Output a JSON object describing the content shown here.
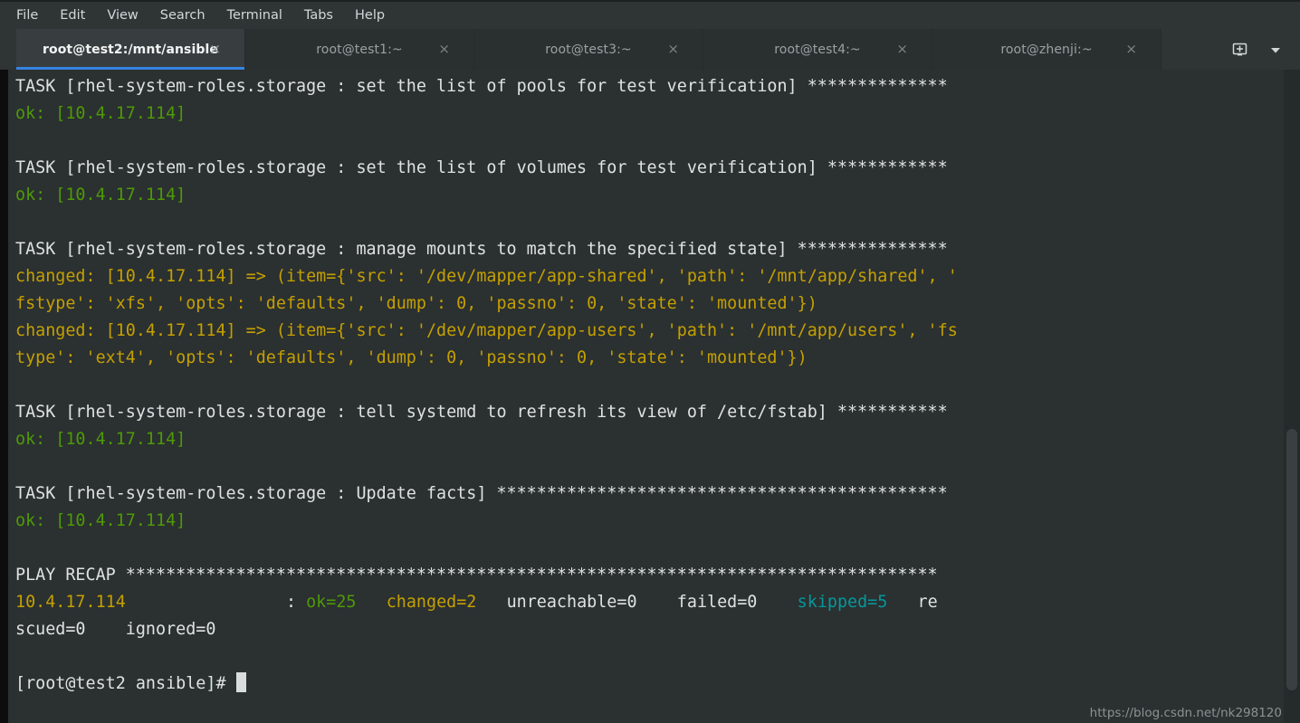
{
  "window": {
    "accent_color": "#3584e4",
    "background": "#2b3031"
  },
  "menubar": {
    "items": [
      {
        "label": "File"
      },
      {
        "label": "Edit"
      },
      {
        "label": "View"
      },
      {
        "label": "Search"
      },
      {
        "label": "Terminal"
      },
      {
        "label": "Tabs"
      },
      {
        "label": "Help"
      }
    ]
  },
  "tabs": {
    "close_glyph": "×",
    "items": [
      {
        "label": "root@test2:/mnt/ansible",
        "active": true
      },
      {
        "label": "root@test1:~",
        "active": false
      },
      {
        "label": "root@test3:~",
        "active": false
      },
      {
        "label": "root@test4:~",
        "active": false
      },
      {
        "label": "root@zhenji:~",
        "active": false
      }
    ],
    "actions": [
      {
        "name": "new-terminal-icon"
      },
      {
        "name": "chevron-down-icon"
      }
    ]
  },
  "terminal": {
    "prompt": "[root@test2 ansible]# ",
    "host": "10.4.17.114",
    "lines": [
      {
        "segments": [
          {
            "text": "TASK [rhel-system-roles.storage : set the list of pools for test verification] **************",
            "color": "white"
          }
        ]
      },
      {
        "segments": [
          {
            "text": "ok: [10.4.17.114]",
            "color": "green"
          }
        ]
      },
      {
        "segments": [
          {
            "text": "",
            "color": "white"
          }
        ]
      },
      {
        "segments": [
          {
            "text": "TASK [rhel-system-roles.storage : set the list of volumes for test verification] ************",
            "color": "white"
          }
        ]
      },
      {
        "segments": [
          {
            "text": "ok: [10.4.17.114]",
            "color": "green"
          }
        ]
      },
      {
        "segments": [
          {
            "text": "",
            "color": "white"
          }
        ]
      },
      {
        "segments": [
          {
            "text": "TASK [rhel-system-roles.storage : manage mounts to match the specified state] ***************",
            "color": "white"
          }
        ]
      },
      {
        "segments": [
          {
            "text": "changed: [10.4.17.114] => (item={'src': '/dev/mapper/app-shared', 'path': '/mnt/app/shared', '",
            "color": "yellow"
          }
        ]
      },
      {
        "segments": [
          {
            "text": "fstype': 'xfs', 'opts': 'defaults', 'dump': 0, 'passno': 0, 'state': 'mounted'})",
            "color": "yellow"
          }
        ]
      },
      {
        "segments": [
          {
            "text": "changed: [10.4.17.114] => (item={'src': '/dev/mapper/app-users', 'path': '/mnt/app/users', 'fs",
            "color": "yellow"
          }
        ]
      },
      {
        "segments": [
          {
            "text": "type': 'ext4', 'opts': 'defaults', 'dump': 0, 'passno': 0, 'state': 'mounted'})",
            "color": "yellow"
          }
        ]
      },
      {
        "segments": [
          {
            "text": "",
            "color": "white"
          }
        ]
      },
      {
        "segments": [
          {
            "text": "TASK [rhel-system-roles.storage : tell systemd to refresh its view of /etc/fstab] ***********",
            "color": "white"
          }
        ]
      },
      {
        "segments": [
          {
            "text": "ok: [10.4.17.114]",
            "color": "green"
          }
        ]
      },
      {
        "segments": [
          {
            "text": "",
            "color": "white"
          }
        ]
      },
      {
        "segments": [
          {
            "text": "TASK [rhel-system-roles.storage : Update facts] *********************************************",
            "color": "white"
          }
        ]
      },
      {
        "segments": [
          {
            "text": "ok: [10.4.17.114]",
            "color": "green"
          }
        ]
      },
      {
        "segments": [
          {
            "text": "",
            "color": "white"
          }
        ]
      },
      {
        "segments": [
          {
            "text": "PLAY RECAP *********************************************************************************",
            "color": "white"
          }
        ]
      },
      {
        "segments": [
          {
            "text": "10.4.17.114",
            "color": "yellow"
          },
          {
            "text": "                : ",
            "color": "white"
          },
          {
            "text": "ok=25",
            "color": "green"
          },
          {
            "text": "   ",
            "color": "white"
          },
          {
            "text": "changed=2",
            "color": "yellow"
          },
          {
            "text": "   unreachable=0    failed=0    ",
            "color": "white"
          },
          {
            "text": "skipped=5",
            "color": "cyan"
          },
          {
            "text": "   re",
            "color": "white"
          }
        ]
      },
      {
        "segments": [
          {
            "text": "scued=0    ignored=0",
            "color": "white"
          }
        ]
      },
      {
        "segments": [
          {
            "text": "",
            "color": "white"
          }
        ]
      }
    ],
    "recap": {
      "host": "10.4.17.114",
      "ok": "ok=25",
      "changed": "changed=2",
      "unreachable": "unreachable=0",
      "failed": "failed=0",
      "skipped": "skipped=5",
      "rescued": "rescued=0",
      "ignored": "ignored=0"
    }
  },
  "watermark": {
    "text": "https://blog.csdn.net/nk298120"
  }
}
